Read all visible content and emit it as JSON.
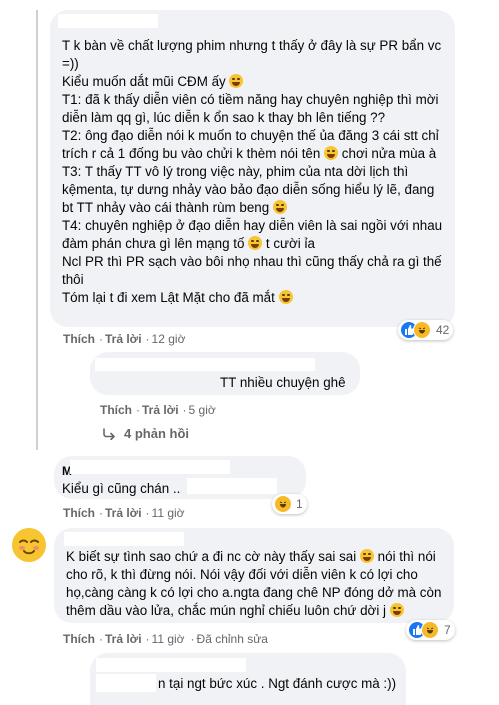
{
  "comments": [
    {
      "text_lines": [
        "T k bàn về chất lượng phim nhưng t thấy ở đây là sự PR bẩn vc =))",
        "Kiểu muốn dắt mũi CĐM ấy",
        "T1: đã k thấy diễn viên có tiềm năng hay chuyên nghiệp thì mời diễn làm qq gì, lúc diễn k ổn sao k thay bh lên tiếng ??",
        "T2: ông đạo diễn nói k muốn to chuyện thế ủa đăng 3 cái stt chỉ trích r cả 1 đống bu vào chửi k thèm nói tên",
        "chơi nửa mùa à",
        "T3: T thấy TT vô lý trong việc này, phim của nta dời lịch thì kệmenta, tự dưng nhảy vào bảo đạo diễn sống hiểu lý lẽ, đang bt TT nhảy vào cái thành rùm beng",
        "T4: chuyên nghiệp ở đạo diễn hay diễn viên là sai ngồi với nhau đàm phán chưa gì lên mạng tố",
        "t cười ỉa",
        "Ncl PR thì PR sạch vào bôi nhọ nhau thì cũng thấy chả ra gì thế thôi",
        "Tóm lại t đi xem Lật Mặt cho đã mắt"
      ],
      "like_label": "Thích",
      "reply_label": "Trả lời",
      "time": "12 giờ",
      "reaction_count": "42"
    },
    {
      "text": "TT nhiều chuyện ghê",
      "like_label": "Thích",
      "reply_label": "Trả lời",
      "time": "5 giờ",
      "replies_label": "4 phản hồi"
    },
    {
      "author_initial": "M",
      "text": "Kiểu gì cũng chán ..",
      "like_label": "Thích",
      "reply_label": "Trả lời",
      "time": "11 giờ",
      "reaction_count": "1"
    },
    {
      "text_lines": [
        "K biết sự tình sao chứ a đi nc cờ này thấy sai sai",
        "nói thì nói cho rõ, k thì đừng nói. Nói vậy đối với diễn viên k có lợi cho họ,càng càng k có lợi cho a.ngta đang chê NP đóng dở mà còn thêm dầu vào lửa, chắc mún nghỉ chiếu luôn chứ dời j"
      ],
      "like_label": "Thích",
      "reply_label": "Trả lời",
      "time": "11 giờ",
      "edited_label": "Đã chỉnh sửa",
      "reaction_count": "7"
    },
    {
      "text": "n tại ngt bức xúc . Ngt đánh cược mà :))"
    }
  ],
  "colors": {
    "bubble": "#f0f2f5",
    "meta": "#65676b",
    "like": "#1877f2",
    "haha": "#f7b928"
  },
  "icons": [
    "like-icon",
    "haha-icon",
    "reply-arrow-icon",
    "grinning-emoji-icon"
  ]
}
